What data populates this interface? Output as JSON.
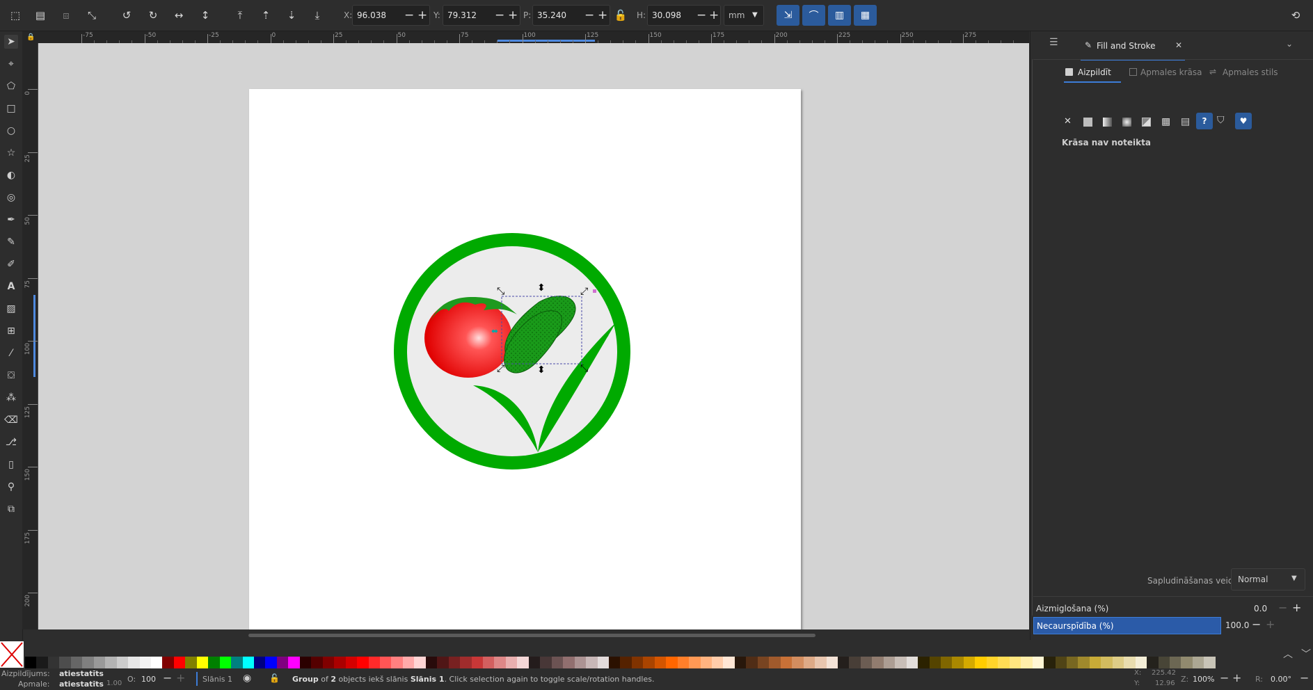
{
  "toolbar": {
    "x_label": "X:",
    "x_value": "96.038",
    "y_label": "Y:",
    "y_value": "79.312",
    "w_label": "P:",
    "w_value": "35.240",
    "h_label": "H:",
    "h_value": "30.098",
    "unit": "mm"
  },
  "ruler": {
    "h_ticks": [
      "-75",
      "-50",
      "-25",
      "0",
      "25",
      "50",
      "75",
      "100",
      "125",
      "150",
      "175",
      "200",
      "225",
      "250",
      "275"
    ],
    "v_ticks": [
      "0",
      "25",
      "50",
      "75",
      "100",
      "125",
      "150",
      "175",
      "200"
    ]
  },
  "panel": {
    "tab_title": "Fill and Stroke",
    "subtab_fill": "Aizpildīt",
    "subtab_stroke_paint": "Apmales krāsa",
    "subtab_stroke_style": "Apmales stils",
    "no_paint_text": "Krāsa nav noteikta",
    "blend_label": "Sapludināšanas veids:",
    "blend_value": "Normal",
    "blur_label": "Aizmiglošana (%)",
    "blur_value": "0.0",
    "opacity_label": "Necaurspīdība (%)",
    "opacity_value": "100.0"
  },
  "palette": [
    "#000000",
    "#1a1a1a",
    "#333333",
    "#4d4d4d",
    "#666666",
    "#808080",
    "#999999",
    "#b3b3b3",
    "#cccccc",
    "#e6e6e6",
    "#f2f2f2",
    "#ffffff",
    "#800000",
    "#ff0000",
    "#808000",
    "#ffff00",
    "#008000",
    "#00ff00",
    "#008080",
    "#00ffff",
    "#000080",
    "#0000ff",
    "#800080",
    "#ff00ff",
    "#2b0000",
    "#550000",
    "#800000",
    "#aa0000",
    "#d40000",
    "#ff0000",
    "#ff2a2a",
    "#ff5555",
    "#ff8080",
    "#ffaaaa",
    "#ffd5d5",
    "#280b0b",
    "#501616",
    "#782121",
    "#a02c2c",
    "#c83737",
    "#d35f5f",
    "#de8787",
    "#e9afaf",
    "#f4d7d7",
    "#241c1c",
    "#483737",
    "#6c5353",
    "#916f6f",
    "#ac9393",
    "#c8b7b7",
    "#e3dbdb",
    "#2b1100",
    "#552200",
    "#803300",
    "#aa4400",
    "#d45500",
    "#ff6600",
    "#ff7f2a",
    "#ff9955",
    "#ffb380",
    "#ffccaa",
    "#ffe6d5",
    "#28170b",
    "#502d16",
    "#784421",
    "#a05a2c",
    "#c87137",
    "#d38d5f",
    "#deaa87",
    "#e9c6af",
    "#f4e3d7",
    "#241f1c",
    "#483e37",
    "#6c5d53",
    "#917c6f",
    "#ac9d93",
    "#c8beb7",
    "#e3dedb",
    "#2b2200",
    "#554400",
    "#806600",
    "#aa8800",
    "#d4aa00",
    "#ffcc00",
    "#ffd42a",
    "#ffdd55",
    "#ffe680",
    "#ffeeaa",
    "#fff6d5",
    "#28220b",
    "#504416",
    "#786721",
    "#a0892c",
    "#c8ab37",
    "#d3bc5f",
    "#decd87",
    "#e9ddaf",
    "#f4eed7",
    "#24221c",
    "#484537",
    "#6c6753",
    "#918a6f",
    "#aca793",
    "#c8c4b7"
  ],
  "status": {
    "fill_label": "Aizpildījums:",
    "fill_value": "atiestatīts",
    "stroke_label": "Apmale:",
    "stroke_value": "atiestatīts",
    "stroke_width": "1.00",
    "opacity_label": "O:",
    "opacity_value": "100",
    "layer": "Slānis 1",
    "message_bold1": "Group",
    "message_part1": " of ",
    "message_bold2": "2",
    "message_part2": " objects iekš slānis ",
    "message_bold3": "Slānis 1",
    "message_part3": ". Click selection again to toggle scale/rotation handles.",
    "cursor_x_label": "X:",
    "cursor_x": "225.42",
    "cursor_y_label": "Y:",
    "cursor_y": "12.96",
    "zoom_label": "Z:",
    "zoom": "100%",
    "rotate_label": "R:",
    "rotation": "0.00°"
  }
}
